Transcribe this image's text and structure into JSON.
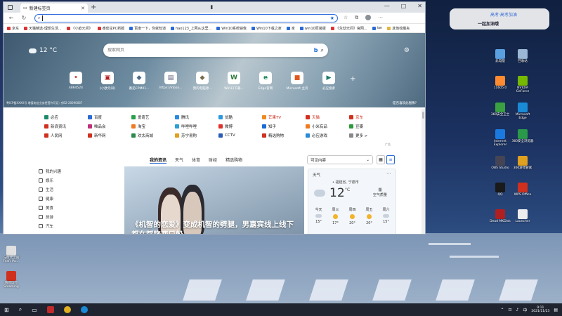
{
  "browser": {
    "tab_title": "新建标签页",
    "address_value": "",
    "favorites": [
      {
        "label": "京东",
        "kind": "red"
      },
      {
        "label": "天猫精选-理想生活...",
        "kind": "red"
      },
      {
        "label": "《小欧元间》",
        "kind": "red"
      },
      {
        "label": "番茄宝PC新版",
        "kind": "red"
      },
      {
        "label": "百度一下，你就知道",
        "kind": "blue"
      },
      {
        "label": "hao123_上网从这里...",
        "kind": "blue"
      },
      {
        "label": "Win10系统镜像",
        "kind": "blue"
      },
      {
        "label": "Win10下载之家",
        "kind": "blue"
      },
      {
        "label": "家",
        "kind": "blue"
      },
      {
        "label": "win10原装版",
        "kind": "blue"
      },
      {
        "label": "《永劫无间》官网...",
        "kind": "red"
      },
      {
        "label": "ian",
        "kind": "blue"
      },
      {
        "label": "其他收藏夹",
        "kind": "folder"
      }
    ]
  },
  "hero": {
    "weather_temp": "12 °C",
    "search_placeholder": "搜索网页",
    "tiles": [
      {
        "label": "4864524",
        "glyph": "•",
        "color": "#d04a4a"
      },
      {
        "label": "《小欧元间》",
        "glyph": "▣",
        "color": "#b02020"
      },
      {
        "label": "番茄CPM01...",
        "glyph": "◆",
        "color": "#4a6a8a"
      },
      {
        "label": "https://inbox...",
        "glyph": "▤",
        "color": "#5a5a7a"
      },
      {
        "label": "我的电脑源...",
        "glyph": "◆",
        "color": "#7a6a4a"
      },
      {
        "label": "Win11下载...",
        "glyph": "W",
        "color": "#2a7a3a"
      },
      {
        "label": "Edge官网",
        "glyph": "e",
        "color": "#1a8a5a"
      },
      {
        "label": "Microsoft 主页",
        "glyph": "■",
        "color": "#e05a20"
      },
      {
        "label": "必应搜索",
        "glyph": "▶",
        "color": "#1a7a6a"
      }
    ],
    "footer_left": "粤ICP备XXXX号 增值电信业务经营许可证: 京B2-20090087",
    "footer_right": "·是否喜欢此图像?"
  },
  "links": [
    {
      "label": "必应",
      "color": "#1a8a6a",
      "red": false
    },
    {
      "label": "百度",
      "color": "#2a6ad6",
      "red": false
    },
    {
      "label": "爱奇艺",
      "color": "#28a04a",
      "red": false
    },
    {
      "label": "腾讯",
      "color": "#2a8ae0",
      "red": false
    },
    {
      "label": "优酷",
      "color": "#2a9ae0",
      "red": false
    },
    {
      "label": "芒果TV",
      "color": "#f08a20",
      "red": true
    },
    {
      "label": "天猫",
      "color": "#d0301e",
      "red": true
    },
    {
      "label": "京东",
      "color": "#d0301e",
      "red": true
    },
    {
      "label": "新浪资讯",
      "color": "#d0301e",
      "red": false
    },
    {
      "label": "唯品会",
      "color": "#c0307a",
      "red": false
    },
    {
      "label": "淘宝",
      "color": "#f07a20",
      "red": false
    },
    {
      "label": "哔哩哔哩",
      "color": "#2aa0d6",
      "red": false
    },
    {
      "label": "微博",
      "color": "#e0302a",
      "red": false
    },
    {
      "label": "知乎",
      "color": "#1a6ad6",
      "red": false
    },
    {
      "label": "小米有品",
      "color": "#f07a20",
      "red": false
    },
    {
      "label": "豆瓣",
      "color": "#2a9a3a",
      "red": false
    },
    {
      "label": "人民网",
      "color": "#d0301e",
      "red": false
    },
    {
      "label": "新华网",
      "color": "#d0301e",
      "red": false
    },
    {
      "label": "欢太商城",
      "color": "#2a8a4a",
      "red": false
    },
    {
      "label": "苏宁易购",
      "color": "#e0a020",
      "red": false
    },
    {
      "label": "CCTV",
      "color": "#2a5ab6",
      "red": false
    },
    {
      "label": "精选购物",
      "color": "#d0301e",
      "red": false
    },
    {
      "label": "必应游戏",
      "color": "#2a8ad6",
      "red": false
    },
    {
      "label": "更多 >",
      "color": "#888888",
      "red": false
    }
  ],
  "ad_label": "广告",
  "news_tabs": [
    "我的资讯",
    "天气",
    "体育",
    "财经",
    "精选购物"
  ],
  "feed_select": "可见内容",
  "left_menu": [
    "我的兴趣",
    "娱乐",
    "生活",
    "健康",
    "美食",
    "旅游",
    "汽车"
  ],
  "news": {
    "headline": "《机智的恋爱》变成机智的劈腿，男嘉宾线上线下都在踩跷两只船"
  },
  "weather": {
    "title": "天气",
    "location": "• 福建省, 宁德市",
    "temp": "12",
    "unit": "°C",
    "condition": "霾",
    "condition_sub": "空气质量",
    "days": [
      {
        "name": "今天",
        "icon": "cloud",
        "temp": "15°"
      },
      {
        "name": "周三",
        "icon": "sun",
        "temp": "17°"
      },
      {
        "name": "周四",
        "icon": "sun",
        "temp": "20°"
      },
      {
        "name": "周五",
        "icon": "sun",
        "temp": "20°"
      },
      {
        "name": "周六",
        "icon": "cloud",
        "temp": "15°"
      }
    ]
  },
  "desktop": {
    "widget_line1": "高考·高考加油",
    "widget_line2": "一起加油哦",
    "icons_right": [
      {
        "label": "此电脑",
        "color": "#5aa0e0"
      },
      {
        "label": "回收站",
        "color": "#9ab8d6"
      },
      {
        "label": "11605.0",
        "color": "#ff8a30"
      },
      {
        "label": "NVIDIA GeForce",
        "color": "#76b900"
      },
      {
        "label": "360安全卫士",
        "color": "#3aa040"
      },
      {
        "label": "Microsoft Edge",
        "color": "#1a8ad6"
      },
      {
        "label": "Internet Explorer",
        "color": "#1a7ae0"
      },
      {
        "label": "360安全浏览器",
        "color": "#2a9a4a"
      },
      {
        "label": "OBS Studio",
        "color": "#444455"
      },
      {
        "label": "360游戏管家",
        "color": "#e0a020"
      },
      {
        "label": "QQ",
        "color": "#1a1a1a"
      },
      {
        "label": "WPS Office",
        "color": "#d0301e"
      },
      {
        "label": "Dead MKDisk",
        "color": "#b02020"
      },
      {
        "label": "Launcher",
        "color": "#eeeeee"
      }
    ],
    "icons_left": [
      {
        "label": "与时代之间 FeaR IAc...",
        "color": "#e0e0e0"
      },
      {
        "label": "暂停运行 Steaming",
        "color": "#d0301e"
      }
    ]
  },
  "taskbar": {
    "time": "9:11",
    "date": "2021/11/23"
  }
}
